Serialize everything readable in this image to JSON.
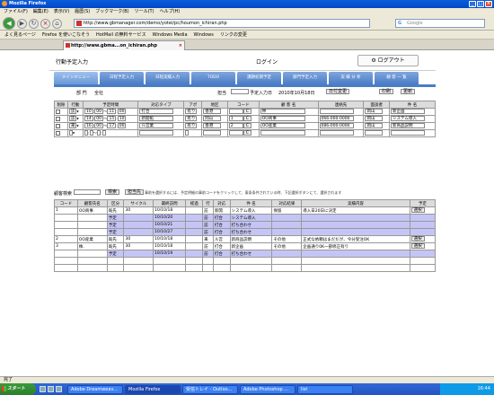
{
  "window": {
    "title": "Mozilla Firefox"
  },
  "menu": [
    "ファイル(F)",
    "編集(E)",
    "表示(V)",
    "履歴(S)",
    "ブックマーク(B)",
    "ツール(T)",
    "ヘルプ(H)"
  ],
  "nav": {
    "url": "http://www.gbmanager.com/demo/yotei/pc/houmon_ichiran.php",
    "search_placeholder": "Google"
  },
  "bookmarks": [
    "よく見るページ",
    "Firefox を使いこなそう",
    "HotMail の無料サービス",
    "Windows Media",
    "Windows",
    "リンクの変更"
  ],
  "tab": {
    "label": "http://www.gbma...on_ichiran.php"
  },
  "app": {
    "title": "行動予定入力",
    "login_label": "ログイン",
    "logout": "ログアウト",
    "tabs": [
      "メインメニュー",
      "日程予定入力",
      "日程実績入力",
      "TODO",
      "課題初期予定",
      "部門予定入力",
      "実 績 分 析",
      "顧 客 一 覧"
    ],
    "dept_label": "部 門",
    "dept_value": "全社",
    "owner_label": "担当",
    "date_label": "予定入力日",
    "date_value": "2010年10月18日",
    "date_change": "日付変更",
    "print": "印刷",
    "update": "更新"
  },
  "entry": {
    "headers": [
      "削除",
      "行動",
      "予定時間",
      "対応タイプ",
      "アポ",
      "地区",
      "コード",
      "顧 客 名",
      "連絡先",
      "面談者",
      "件 名"
    ],
    "rows": [
      {
        "action": "訪",
        "from_h": "10",
        "from_m": "00",
        "to_h": "11",
        "to_m": "00",
        "type": "打合",
        "apo": "有り",
        "area": "香港",
        "code": "",
        "customer": "林",
        "contact": "",
        "person": "岡山",
        "subject": "新企画"
      },
      {
        "action": "訪",
        "from_h": "14",
        "from_m": "00",
        "to_h": "15",
        "to_m": "10",
        "type": "新開拓",
        "apo": "有り",
        "area": "岡山",
        "code": "1",
        "customer": "OO商事",
        "contact": "066-000-0000",
        "person": "岡山",
        "subject": "システム導入"
      },
      {
        "action": "来",
        "from_h": "16",
        "from_m": "00",
        "to_h": "17",
        "to_m": "00",
        "type": "ル営業",
        "apo": "有り",
        "area": "香港",
        "code": "2",
        "customer": "OO産業",
        "contact": "086-000-0000",
        "person": "岡山",
        "subject": "新商品説明"
      },
      {
        "action": "",
        "from_h": "",
        "from_m": "",
        "to_h": "",
        "to_m": "",
        "type": "",
        "apo": "",
        "area": "",
        "code": "",
        "customer": "",
        "contact": "",
        "person": "",
        "subject": ""
      }
    ],
    "code_btn": "C"
  },
  "search": {
    "label": "顧客検索",
    "search_btn": "検索",
    "owner_btn": "担当先",
    "note": "事前を選択するには、予定明細の事前コードをクリックして、東条条件されている時、下記選択ボタンにて、選択されます"
  },
  "list": {
    "headers": [
      "コード",
      "顧客氏名",
      "区分",
      "サイクル",
      "最終訪問",
      "経過",
      "行",
      "対応",
      "件 名",
      "対応結果",
      "実績内容",
      "予定"
    ],
    "rows": [
      {
        "code": "1",
        "name": "OO商事",
        "kbn": "既先",
        "cycle": "30",
        "last": "10/10/18",
        "elapsed": "",
        "go": "訪",
        "type": "新開",
        "subject": "システム導入",
        "result": "保留",
        "detail": "導入日20日に決定",
        "btn": "選択",
        "hl": false
      },
      {
        "code": "",
        "name": "",
        "kbn": "予定",
        "cycle": "",
        "last": "10/10/20",
        "elapsed": "",
        "go": "訪",
        "type": "打合",
        "subject": "システム導入",
        "result": "",
        "detail": "",
        "btn": "",
        "hl": true
      },
      {
        "code": "",
        "name": "",
        "kbn": "予定",
        "cycle": "",
        "last": "10/10/21",
        "elapsed": "",
        "go": "訪",
        "type": "打合",
        "subject": "打ち合わせ",
        "result": "",
        "detail": "",
        "btn": "",
        "hl": true
      },
      {
        "code": "",
        "name": "",
        "kbn": "予定",
        "cycle": "",
        "last": "10/10/27",
        "elapsed": "",
        "go": "訪",
        "type": "打合",
        "subject": "打ち合わせ",
        "result": "",
        "detail": "",
        "btn": "",
        "hl": true
      },
      {
        "code": "2",
        "name": "OO産業",
        "kbn": "既先",
        "cycle": "30",
        "last": "10/10/18",
        "elapsed": "",
        "go": "来",
        "type": "ル営",
        "subject": "新商品説明",
        "result": "その他",
        "detail": "正式な依頼はまだだが、今分受注OK",
        "btn": "選択",
        "hl": false
      },
      {
        "code": "3",
        "name": "株.",
        "kbn": "既先",
        "cycle": "30",
        "last": "10/10/18",
        "elapsed": "",
        "go": "訪",
        "type": "打合",
        "subject": "新企画",
        "result": "その他",
        "detail": "企画通り0K一部修正有り",
        "btn": "選択",
        "hl": false
      },
      {
        "code": "",
        "name": "",
        "kbn": "予定",
        "cycle": "",
        "last": "10/10/19",
        "elapsed": "",
        "go": "訪",
        "type": "打合",
        "subject": "打ち合わせ",
        "result": "",
        "detail": "",
        "btn": "",
        "hl": true
      }
    ]
  },
  "status": "完了",
  "taskbar": {
    "start": "スタート",
    "tasks": [
      "Adobe Dreamweav...",
      "Mozilla Firefox",
      "受信トレイ - Outloo...",
      "Adobe Photoshop ...",
      "list"
    ],
    "clock": "16:44"
  }
}
